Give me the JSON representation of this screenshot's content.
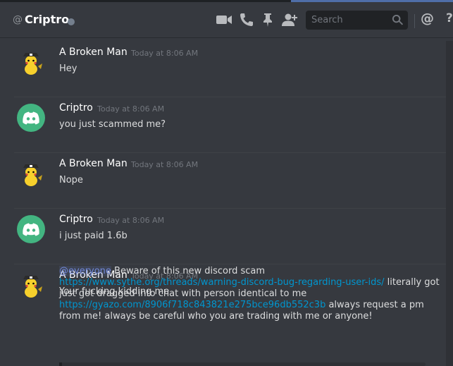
{
  "header": {
    "at_symbol": "@",
    "channel_name": "Criptro",
    "status_color": "#747f8d",
    "icons": [
      "video-icon",
      "phone-icon",
      "pin-icon",
      "add-user-icon"
    ],
    "search_placeholder": "Search",
    "mention_symbol": "@",
    "help_symbol": "?"
  },
  "messages": [
    {
      "author": "A Broken Man",
      "timestamp": "Today at 8:06 AM",
      "avatar": "pirate-pikachu-avatar",
      "lines": [
        "Hey"
      ]
    },
    {
      "author": "Criptro",
      "timestamp": "Today at 8:06 AM",
      "avatar": "discord-logo-avatar",
      "lines": [
        "you just scammed me?"
      ]
    },
    {
      "author": "A Broken Man",
      "timestamp": "Today at 8:06 AM",
      "avatar": "pirate-pikachu-avatar",
      "lines": [
        "Nope"
      ]
    },
    {
      "author": "Criptro",
      "timestamp": "Today at 8:06 AM",
      "avatar": "discord-logo-avatar",
      "lines": [
        "i just paid 1.6b"
      ]
    },
    {
      "author": "A Broken Man",
      "timestamp": "Today at 8:06 AM",
      "avatar": "pirate-pikachu-avatar",
      "lines": [
        "Your fucking kidding me"
      ]
    }
  ],
  "warning": {
    "mention": "@everyone",
    "line1": " Beware of this new discord scam",
    "link1": "https://www.sythe.org/threads/warning-discord-bug-regarding-user-ids/",
    "text2": " literally got just got dragged into chat with person identical to me",
    "link2": "https://gyazo.com/8906f718c843821e275bce96db552c3b",
    "text3": " always request a pm from me! always be careful who you are trading with me or anyone!"
  },
  "colors": {
    "background": "#36393f",
    "username": "#ffffff",
    "timestamp": "#72767d",
    "link": "#0096cf",
    "mention": "#7289da",
    "discord_avatar_bg": "#43b581"
  }
}
